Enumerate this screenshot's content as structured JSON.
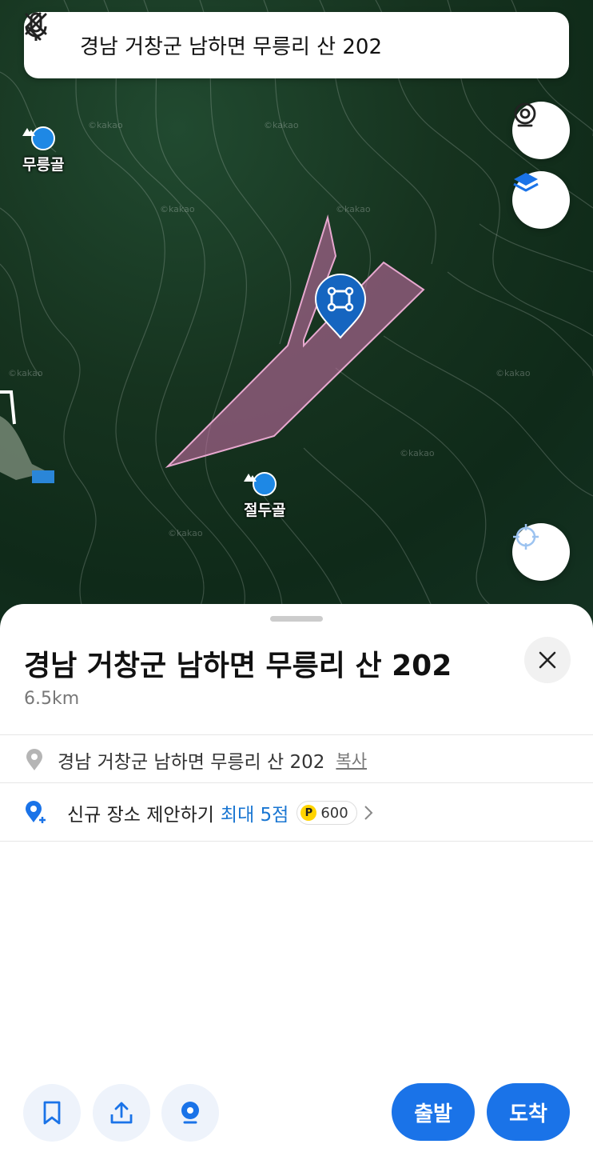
{
  "search": {
    "query": "경남 거창군 남하면 무릉리 산 202"
  },
  "map": {
    "pois": [
      {
        "label": "무릉골"
      },
      {
        "label": "절두골"
      }
    ],
    "watermark": "©kakao",
    "parcel_color": "#c06aa0"
  },
  "sheet": {
    "title": "경남 거창군 남하면 무릉리 산 202",
    "distance": "6.5km",
    "address": "경남 거창군 남하면 무릉리 산 202",
    "copy_label": "복사",
    "suggest": {
      "label": "신규 장소 제안하기",
      "max_points": "최대 5점",
      "point_badge": "600",
      "point_icon": "P"
    },
    "buttons": {
      "depart": "출발",
      "arrive": "도착"
    }
  },
  "colors": {
    "accent": "#1a73e8",
    "pin": "#1565c0"
  }
}
